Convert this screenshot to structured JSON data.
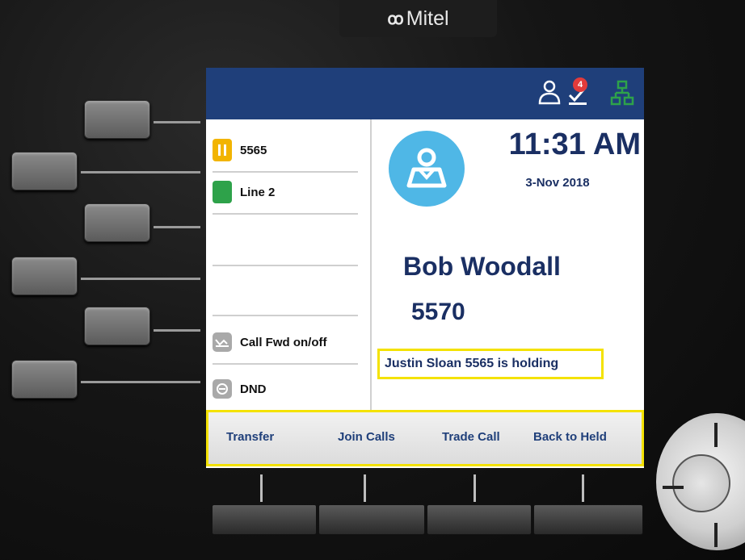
{
  "brand": {
    "name": "Mitel",
    "glyph": "ꝏ"
  },
  "status_bar": {
    "icons": [
      "contacts-icon",
      "voicemail-icon",
      "network-icon"
    ],
    "voicemail_count": "4",
    "colors": {
      "bar": "#1f3f7a",
      "badge": "#e23b3b",
      "network": "#2ea24a"
    }
  },
  "lines": [
    {
      "label": "5565",
      "state": "hold",
      "icon": "pause-icon"
    },
    {
      "label": "Line 2",
      "state": "idle",
      "icon": "line-indicator-icon"
    }
  ],
  "features": [
    {
      "label": "Call Fwd on/off",
      "icon": "call-forward-icon"
    },
    {
      "label": "DND",
      "icon": "dnd-icon"
    }
  ],
  "clock": {
    "time": "11:31 AM",
    "date": "3-Nov 2018"
  },
  "call": {
    "name": "Bob Woodall",
    "number": "5570",
    "hold_message": "Justin Sloan 5565 is holding"
  },
  "softkeys": [
    "Transfer",
    "Join Calls",
    "Trade Call",
    "Back to Held"
  ],
  "colors": {
    "accent_text": "#1a2f63",
    "highlight": "#f4e200",
    "avatar": "#4fb7e6",
    "hold": "#f2b400"
  }
}
